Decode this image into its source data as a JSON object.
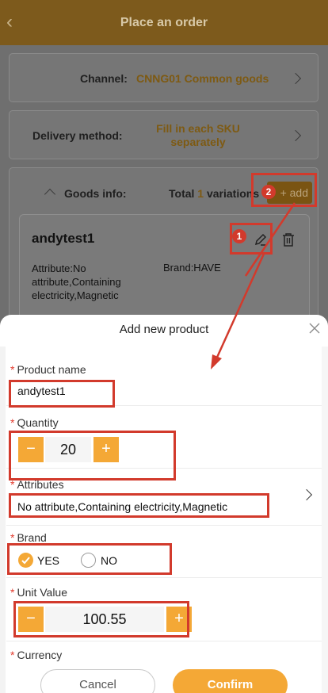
{
  "header": {
    "title": "Place an order"
  },
  "channel": {
    "label": "Channel:",
    "value": "CNNG01 Common goods"
  },
  "delivery": {
    "label": "Delivery method:",
    "value": "Fill in each SKU separately"
  },
  "goods": {
    "label": "Goods info:",
    "total_prefix": "Total",
    "total_count": "1",
    "total_suffix": "variations",
    "add_label": "+ add",
    "item": {
      "name": "andytest1",
      "attribute": "Attribute:No attribute,Containing electricity,Magnetic",
      "brand": "Brand:HAVE"
    }
  },
  "annotations": {
    "marker_1": "1",
    "marker_2": "2"
  },
  "modal": {
    "title": "Add new product",
    "product_name": {
      "label": "Product name",
      "value": "andytest1"
    },
    "quantity": {
      "label": "Quantity",
      "value": "20",
      "minus": "−",
      "plus": "+"
    },
    "attributes": {
      "label": "Attributes",
      "value": "No attribute,Containing electricity,Magnetic"
    },
    "brand": {
      "label": "Brand",
      "options": [
        "YES",
        "NO"
      ],
      "selected": "YES"
    },
    "unit_value": {
      "label": "Unit Value",
      "value": "100.55",
      "minus": "−",
      "plus": "+"
    },
    "currency": {
      "label": "Currency"
    },
    "cancel_label": "Cancel",
    "confirm_label": "Confirm"
  },
  "colors": {
    "accent": "#f4a836",
    "annotation": "#d23a2c"
  }
}
